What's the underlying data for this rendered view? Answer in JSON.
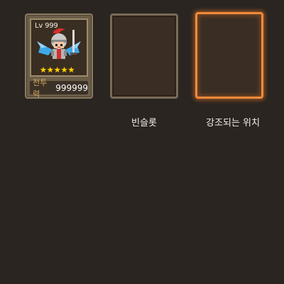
{
  "hero_card": {
    "level": "Lv 999",
    "star_count": 5,
    "star_glyph": "★",
    "power_label": "전투력",
    "power_value": "999999",
    "portrait_icon": "knight-hero-icon"
  },
  "empty_slot": {
    "caption": "빈슬롯"
  },
  "highlight_slot": {
    "caption": "강조되는 위치",
    "glow_color": "#f08a3a"
  },
  "colors": {
    "background": "#2a2521",
    "star": "#ffd400",
    "power_label": "#d8a85a"
  }
}
